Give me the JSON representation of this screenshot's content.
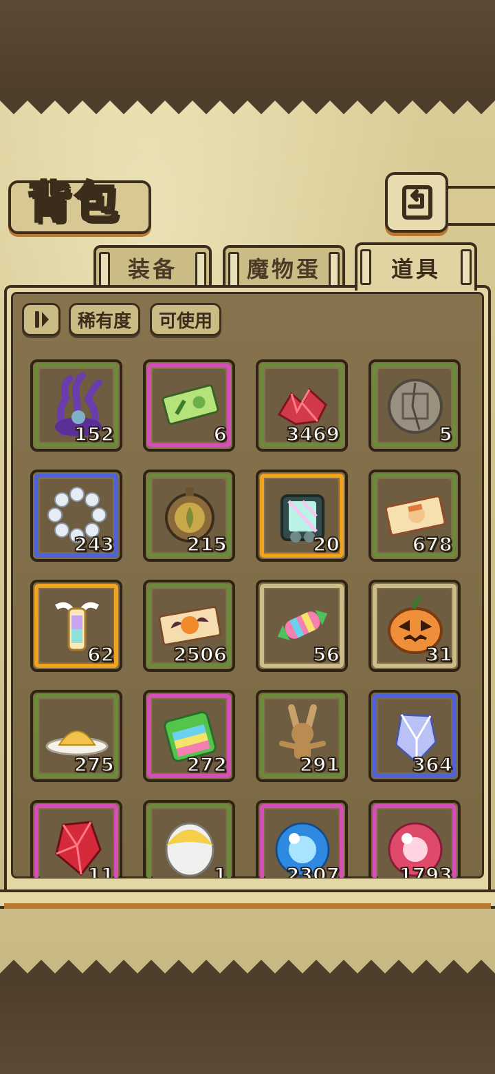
{
  "header": {
    "title": "背包",
    "back_icon": "return-arrow-icon"
  },
  "tabs": [
    {
      "label": "装备",
      "active": false
    },
    {
      "label": "魔物蛋",
      "active": false
    },
    {
      "label": "道具",
      "active": true
    }
  ],
  "filters": {
    "sort_icon": "sort-toggle-icon",
    "rarity_label": "稀有度",
    "usable_label": "可使用"
  },
  "rarity_colors": {
    "green": "#6b8a3a",
    "pink": "#d64fb6",
    "blue": "#4f62d8",
    "gold": "#f1a21e",
    "plain": "#cdbd8a"
  },
  "items": [
    {
      "icon": "purple-tentacle-plant-icon",
      "count": "152",
      "rarity": "green"
    },
    {
      "icon": "green-ticket-icon",
      "count": "6",
      "rarity": "pink"
    },
    {
      "icon": "red-crystal-ore-icon",
      "count": "3469",
      "rarity": "green"
    },
    {
      "icon": "stone-tablet-icon",
      "count": "5",
      "rarity": "green"
    },
    {
      "icon": "pearl-bracelet-icon",
      "count": "243",
      "rarity": "blue"
    },
    {
      "icon": "leaf-emblem-icon",
      "count": "215",
      "rarity": "green"
    },
    {
      "icon": "crystal-capsule-icon",
      "count": "20",
      "rarity": "gold"
    },
    {
      "icon": "character-ticket-icon",
      "count": "678",
      "rarity": "green"
    },
    {
      "icon": "winged-lantern-icon",
      "count": "62",
      "rarity": "gold"
    },
    {
      "icon": "pumpkin-ticket-icon",
      "count": "2506",
      "rarity": "green"
    },
    {
      "icon": "rainbow-candy-icon",
      "count": "56",
      "rarity": "plain"
    },
    {
      "icon": "jack-o-lantern-icon",
      "count": "31",
      "rarity": "plain"
    },
    {
      "icon": "gold-powder-plate-icon",
      "count": "275",
      "rarity": "green"
    },
    {
      "icon": "rainbow-block-icon",
      "count": "272",
      "rarity": "pink"
    },
    {
      "icon": "voodoo-doll-icon",
      "count": "291",
      "rarity": "green"
    },
    {
      "icon": "blue-crystal-shard-icon",
      "count": "364",
      "rarity": "blue"
    },
    {
      "icon": "red-gem-icon",
      "count": "11",
      "rarity": "pink"
    },
    {
      "icon": "white-yellow-egg-icon",
      "count": "1",
      "rarity": "green"
    },
    {
      "icon": "blue-orb-icon",
      "count": "2307",
      "rarity": "pink"
    },
    {
      "icon": "pink-orb-icon",
      "count": "1793",
      "rarity": "pink"
    }
  ]
}
